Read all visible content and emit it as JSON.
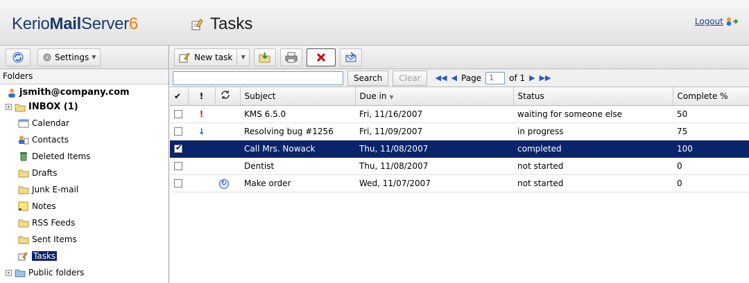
{
  "header": {
    "brand": {
      "part1": "Kerio",
      "part2": "Mail",
      "part3": "Server",
      "part4": "6"
    },
    "title": "Tasks",
    "logout": "Logout"
  },
  "left_toolbar": {
    "settings": "Settings"
  },
  "folders": {
    "heading": "Folders",
    "account": "jsmith@company.com",
    "items": [
      {
        "label": "INBOX (1)",
        "icon": "folder-icon"
      },
      {
        "label": "Calendar",
        "icon": "calendar-icon"
      },
      {
        "label": "Contacts",
        "icon": "contacts-icon"
      },
      {
        "label": "Deleted Items",
        "icon": "trash-icon"
      },
      {
        "label": "Drafts",
        "icon": "folder-icon"
      },
      {
        "label": "Junk E-mail",
        "icon": "folder-icon"
      },
      {
        "label": "Notes",
        "icon": "notes-icon"
      },
      {
        "label": "RSS Feeds",
        "icon": "folder-icon"
      },
      {
        "label": "Sent Items",
        "icon": "folder-icon"
      },
      {
        "label": "Tasks",
        "icon": "tasks-icon"
      },
      {
        "label": "Public folders",
        "icon": "folder-icon"
      }
    ]
  },
  "toolbar": {
    "new_task": "New task"
  },
  "search": {
    "button": "Search",
    "clear": "Clear"
  },
  "pager": {
    "page_label": "Page",
    "page_value": "1",
    "of_label": "of 1"
  },
  "table": {
    "headers": {
      "check": "✔",
      "priority": "!",
      "recurrence": "",
      "subject": "Subject",
      "due": "Due in",
      "status": "Status",
      "complete": "Complete %"
    },
    "rows": [
      {
        "checked": false,
        "priority": "high",
        "recurring": false,
        "subject": "KMS 6.5.0",
        "due": "Fri, 11/16/2007",
        "status": "waiting for someone else",
        "complete": "50",
        "selected": false
      },
      {
        "checked": false,
        "priority": "low",
        "recurring": false,
        "subject": "Resolving bug #1256",
        "due": "Fri, 11/09/2007",
        "status": "in progress",
        "complete": "75",
        "selected": false
      },
      {
        "checked": true,
        "priority": "",
        "recurring": false,
        "subject": "Call Mrs. Nowack",
        "due": "Thu, 11/08/2007",
        "status": "completed",
        "complete": "100",
        "selected": true
      },
      {
        "checked": false,
        "priority": "",
        "recurring": false,
        "subject": "Dentist",
        "due": "Thu, 11/08/2007",
        "status": "not started",
        "complete": "0",
        "selected": false
      },
      {
        "checked": false,
        "priority": "",
        "recurring": true,
        "subject": "Make order",
        "due": "Wed, 11/07/2007",
        "status": "not started",
        "complete": "0",
        "selected": false
      }
    ]
  },
  "colors": {
    "brand_blue": "#1b3a6b",
    "brand_orange": "#ee7a00",
    "selection": "#0a246a"
  }
}
